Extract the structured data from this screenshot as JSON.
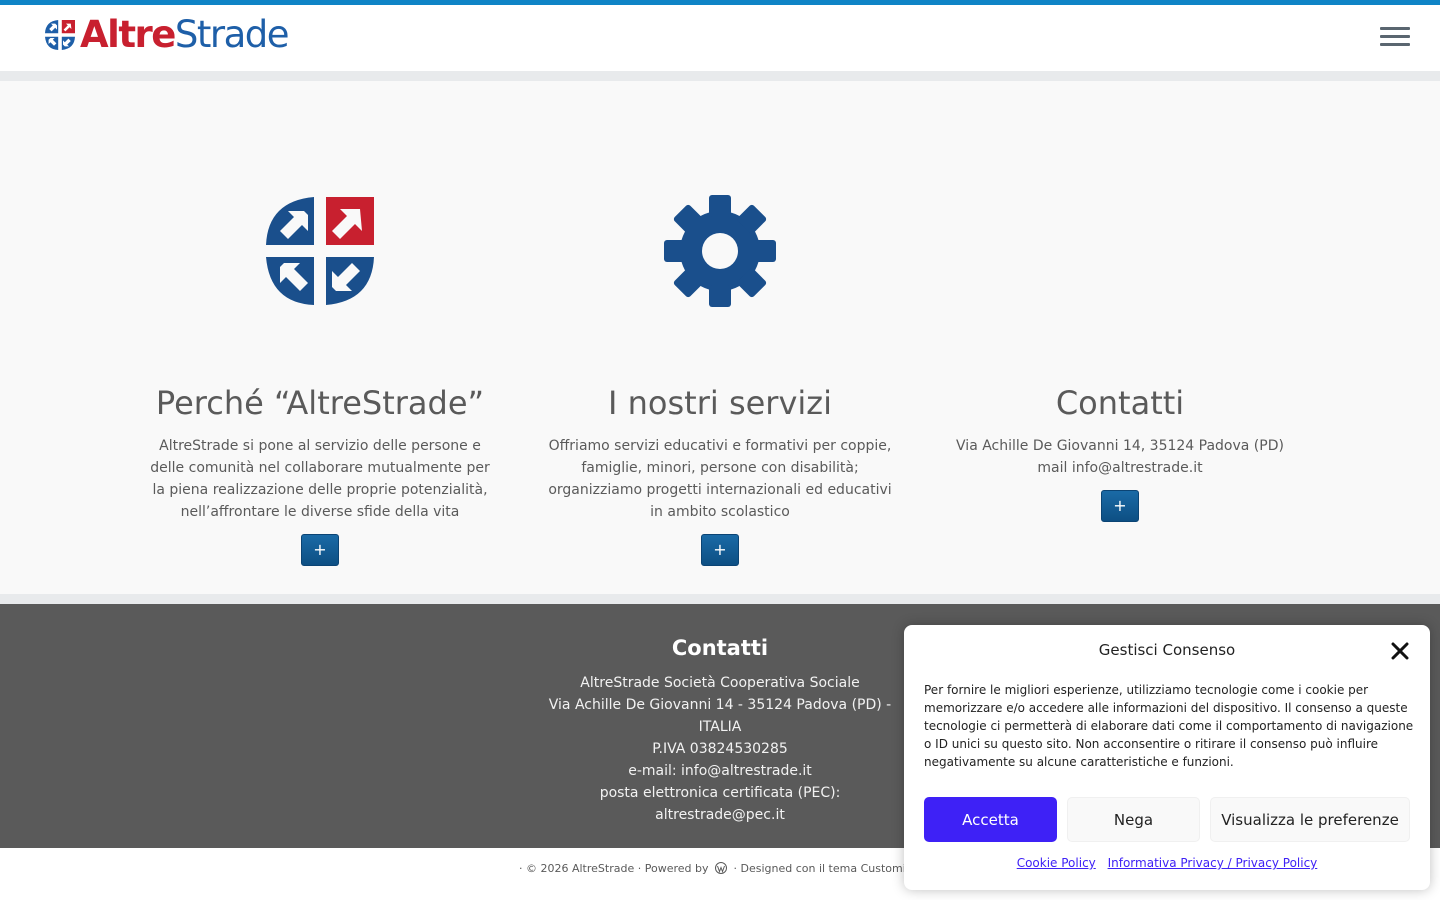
{
  "colors": {
    "topbar": "#0f84c6",
    "brand_red": "#c8202f",
    "brand_blue": "#1e5fa8",
    "icon_blue": "#1a4f8c",
    "footer_bg": "#5a5a5a",
    "accept_button": "#3e21f6"
  },
  "header": {
    "logo_part1": "Altre",
    "logo_part2": "Strade",
    "menu_icon": "hamburger-icon"
  },
  "features": [
    {
      "icon": "altrestrade-emblem-icon",
      "title": "Perché “AltreStrade”",
      "text": "AltreStrade si pone al servizio delle persone e delle comunità nel collaborare mutualmente per la piena realizzazione delle proprie potenzialità, nell’affrontare le diverse sfide della vita",
      "button": "+"
    },
    {
      "icon": "gear-icon",
      "title": "I nostri servizi",
      "text": "Offriamo servizi educativi e formativi per coppie, famiglie, minori, persone con disabilità; organizziamo progetti internazionali ed educativi in ambito scolastico",
      "button": "+"
    },
    {
      "title": "Contatti",
      "lines": [
        "Via Achille De Giovanni 14, 35124 Padova (PD)",
        "mail info@altrestrade.it"
      ],
      "button": "+"
    }
  ],
  "footer": {
    "title": "Contatti",
    "lines": [
      "AltreStrade Società Cooperativa Sociale",
      "Via Achille De Giovanni 14 - 35124 Padova (PD) - ITALIA",
      "P.IVA 03824530285",
      "e-mail: info@altrestrade.it",
      "posta elettronica certificata (PEC): altrestrade@pec.it"
    ]
  },
  "credits": {
    "copyright": "· © 2026 AltreStrade · Powered by",
    "designed": "· Designed con il tema Customiz"
  },
  "consent": {
    "title": "Gestisci Consenso",
    "text": "Per fornire le migliori esperienze, utilizziamo tecnologie come i cookie per memorizzare e/o accedere alle informazioni del dispositivo. Il consenso a queste tecnologie ci permetterà di elaborare dati come il comportamento di navigazione o ID unici su questo sito. Non acconsentire o ritirare il consenso può influire negativamente su alcune caratteristiche e funzioni.",
    "accept": "Accetta",
    "deny": "Nega",
    "preferences": "Visualizza le preferenze",
    "link_cookie": "Cookie Policy",
    "link_privacy": "Informativa Privacy / Privacy Policy"
  }
}
